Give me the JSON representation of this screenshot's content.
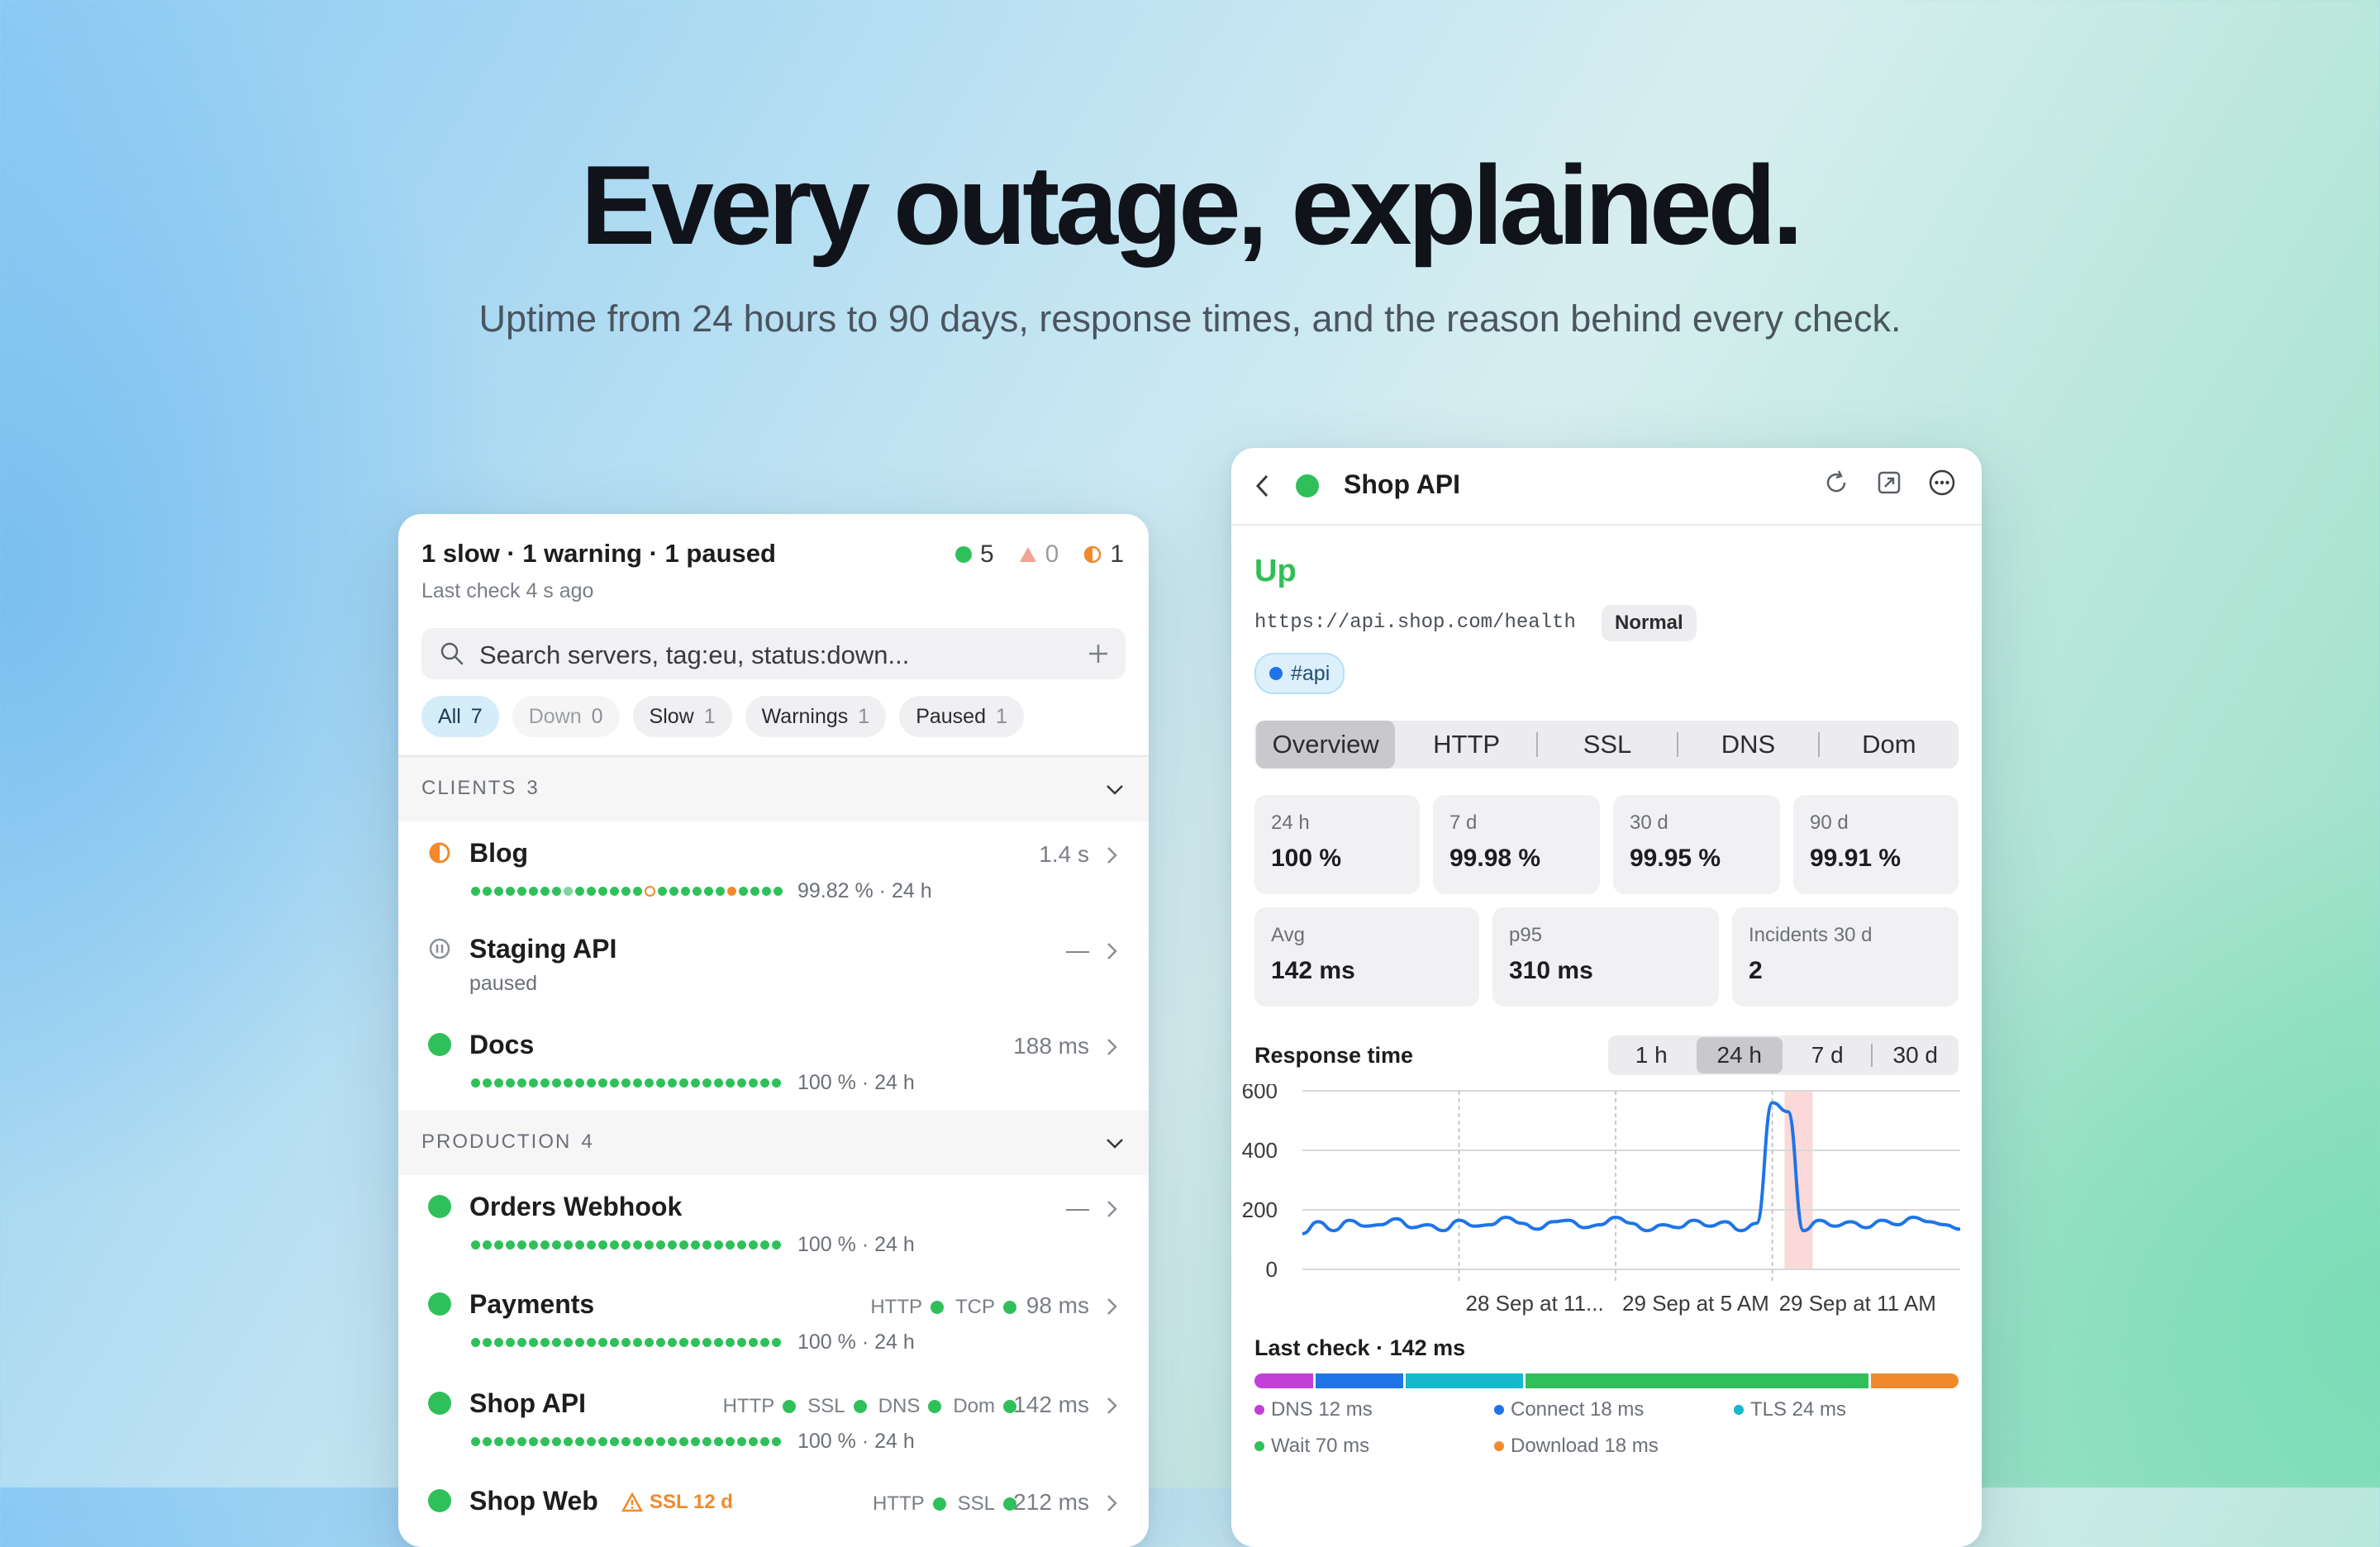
{
  "hero": {
    "title": "Every outage, explained.",
    "subtitle": "Uptime from 24 hours to 90 days, response times, and the reason behind every check."
  },
  "list_panel": {
    "summary": "1 slow · 1 warning · 1 paused",
    "last_check": "Last check 4 s ago",
    "counts": {
      "up": "5",
      "down": "0",
      "slow": "1"
    },
    "search": {
      "placeholder": "Search servers, tag:eu, status:down..."
    },
    "filters": [
      {
        "label": "All",
        "count": "7"
      },
      {
        "label": "Down",
        "count": "0"
      },
      {
        "label": "Slow",
        "count": "1"
      },
      {
        "label": "Warnings",
        "count": "1"
      },
      {
        "label": "Paused",
        "count": "1"
      }
    ],
    "sections": [
      {
        "label": "CLIENTS",
        "count": "3",
        "rows": [
          {
            "name": "Blog",
            "meta": "1.4 s",
            "sub": "99.82 % · 24 h",
            "status": "slow"
          },
          {
            "name": "Staging API",
            "meta": "—",
            "sub": "paused",
            "status": "paused"
          },
          {
            "name": "Docs",
            "meta": "188 ms",
            "sub": "100 % · 24 h",
            "status": "up"
          }
        ]
      },
      {
        "label": "PRODUCTION",
        "count": "4",
        "rows": [
          {
            "name": "Orders Webhook",
            "meta": "—",
            "sub": "100 % · 24 h",
            "status": "up"
          },
          {
            "name": "Payments",
            "meta": "98 ms",
            "sub": "100 % · 24 h",
            "status": "up",
            "checks": [
              "HTTP",
              "TCP"
            ]
          },
          {
            "name": "Shop API",
            "meta": "142 ms",
            "sub": "100 % · 24 h",
            "status": "up",
            "checks": [
              "HTTP",
              "SSL",
              "DNS",
              "Dom"
            ]
          },
          {
            "name": "Shop Web",
            "meta": "212 ms",
            "status": "up",
            "warning": "SSL 12 d",
            "checks": [
              "HTTP",
              "SSL"
            ]
          }
        ]
      }
    ]
  },
  "detail_panel": {
    "title": "Shop API",
    "status": "Up",
    "url": "https://api.shop.com/health",
    "badge": "Normal",
    "tag": "#api",
    "tabs": [
      "Overview",
      "HTTP",
      "SSL",
      "DNS",
      "Dom"
    ],
    "uptime": [
      {
        "label": "24 h",
        "value": "100 %"
      },
      {
        "label": "7 d",
        "value": "99.98 %"
      },
      {
        "label": "30 d",
        "value": "99.95 %"
      },
      {
        "label": "90 d",
        "value": "99.91 %"
      }
    ],
    "stats": [
      {
        "label": "Avg",
        "value": "142 ms"
      },
      {
        "label": "p95",
        "value": "310 ms"
      },
      {
        "label": "Incidents 30 d",
        "value": "2"
      }
    ],
    "response_label": "Response time",
    "ranges": [
      "1 h",
      "24 h",
      "7 d",
      "30 d"
    ],
    "last_check_label": "Last check · 142 ms",
    "timing": [
      {
        "label": "DNS 12 ms",
        "ms": 12,
        "color": "#c23fd8"
      },
      {
        "label": "Connect 18 ms",
        "ms": 18,
        "color": "#1f74e8"
      },
      {
        "label": "TLS 24 ms",
        "ms": 24,
        "color": "#17b7cc"
      },
      {
        "label": "Wait 70 ms",
        "ms": 70,
        "color": "#30c05a"
      },
      {
        "label": "Download 18 ms",
        "ms": 18,
        "color": "#f08a2c"
      }
    ]
  },
  "chart_data": {
    "type": "line",
    "ylim": [
      0,
      600
    ],
    "yticks": [
      "0",
      "200",
      "400",
      "600"
    ],
    "x_ticks": [
      "28 Sep at 11...",
      "29 Sep at 5 AM",
      "29 Sep at 11 AM"
    ],
    "series": [
      {
        "color": "#1f74e8",
        "values": [
          120,
          160,
          130,
          165,
          145,
          150,
          170,
          140,
          150,
          130,
          165,
          145,
          150,
          175,
          155,
          135,
          160,
          165,
          140,
          150,
          175,
          155,
          130,
          150,
          140,
          165,
          145,
          160,
          130,
          155,
          560,
          530,
          130,
          165,
          145,
          160,
          140,
          165,
          150,
          175,
          160,
          150,
          135
        ]
      }
    ],
    "incident_index": 31
  },
  "colors": {
    "up": "#30c05a",
    "slow": "#f08a2c",
    "accent": "#1f74e8"
  }
}
